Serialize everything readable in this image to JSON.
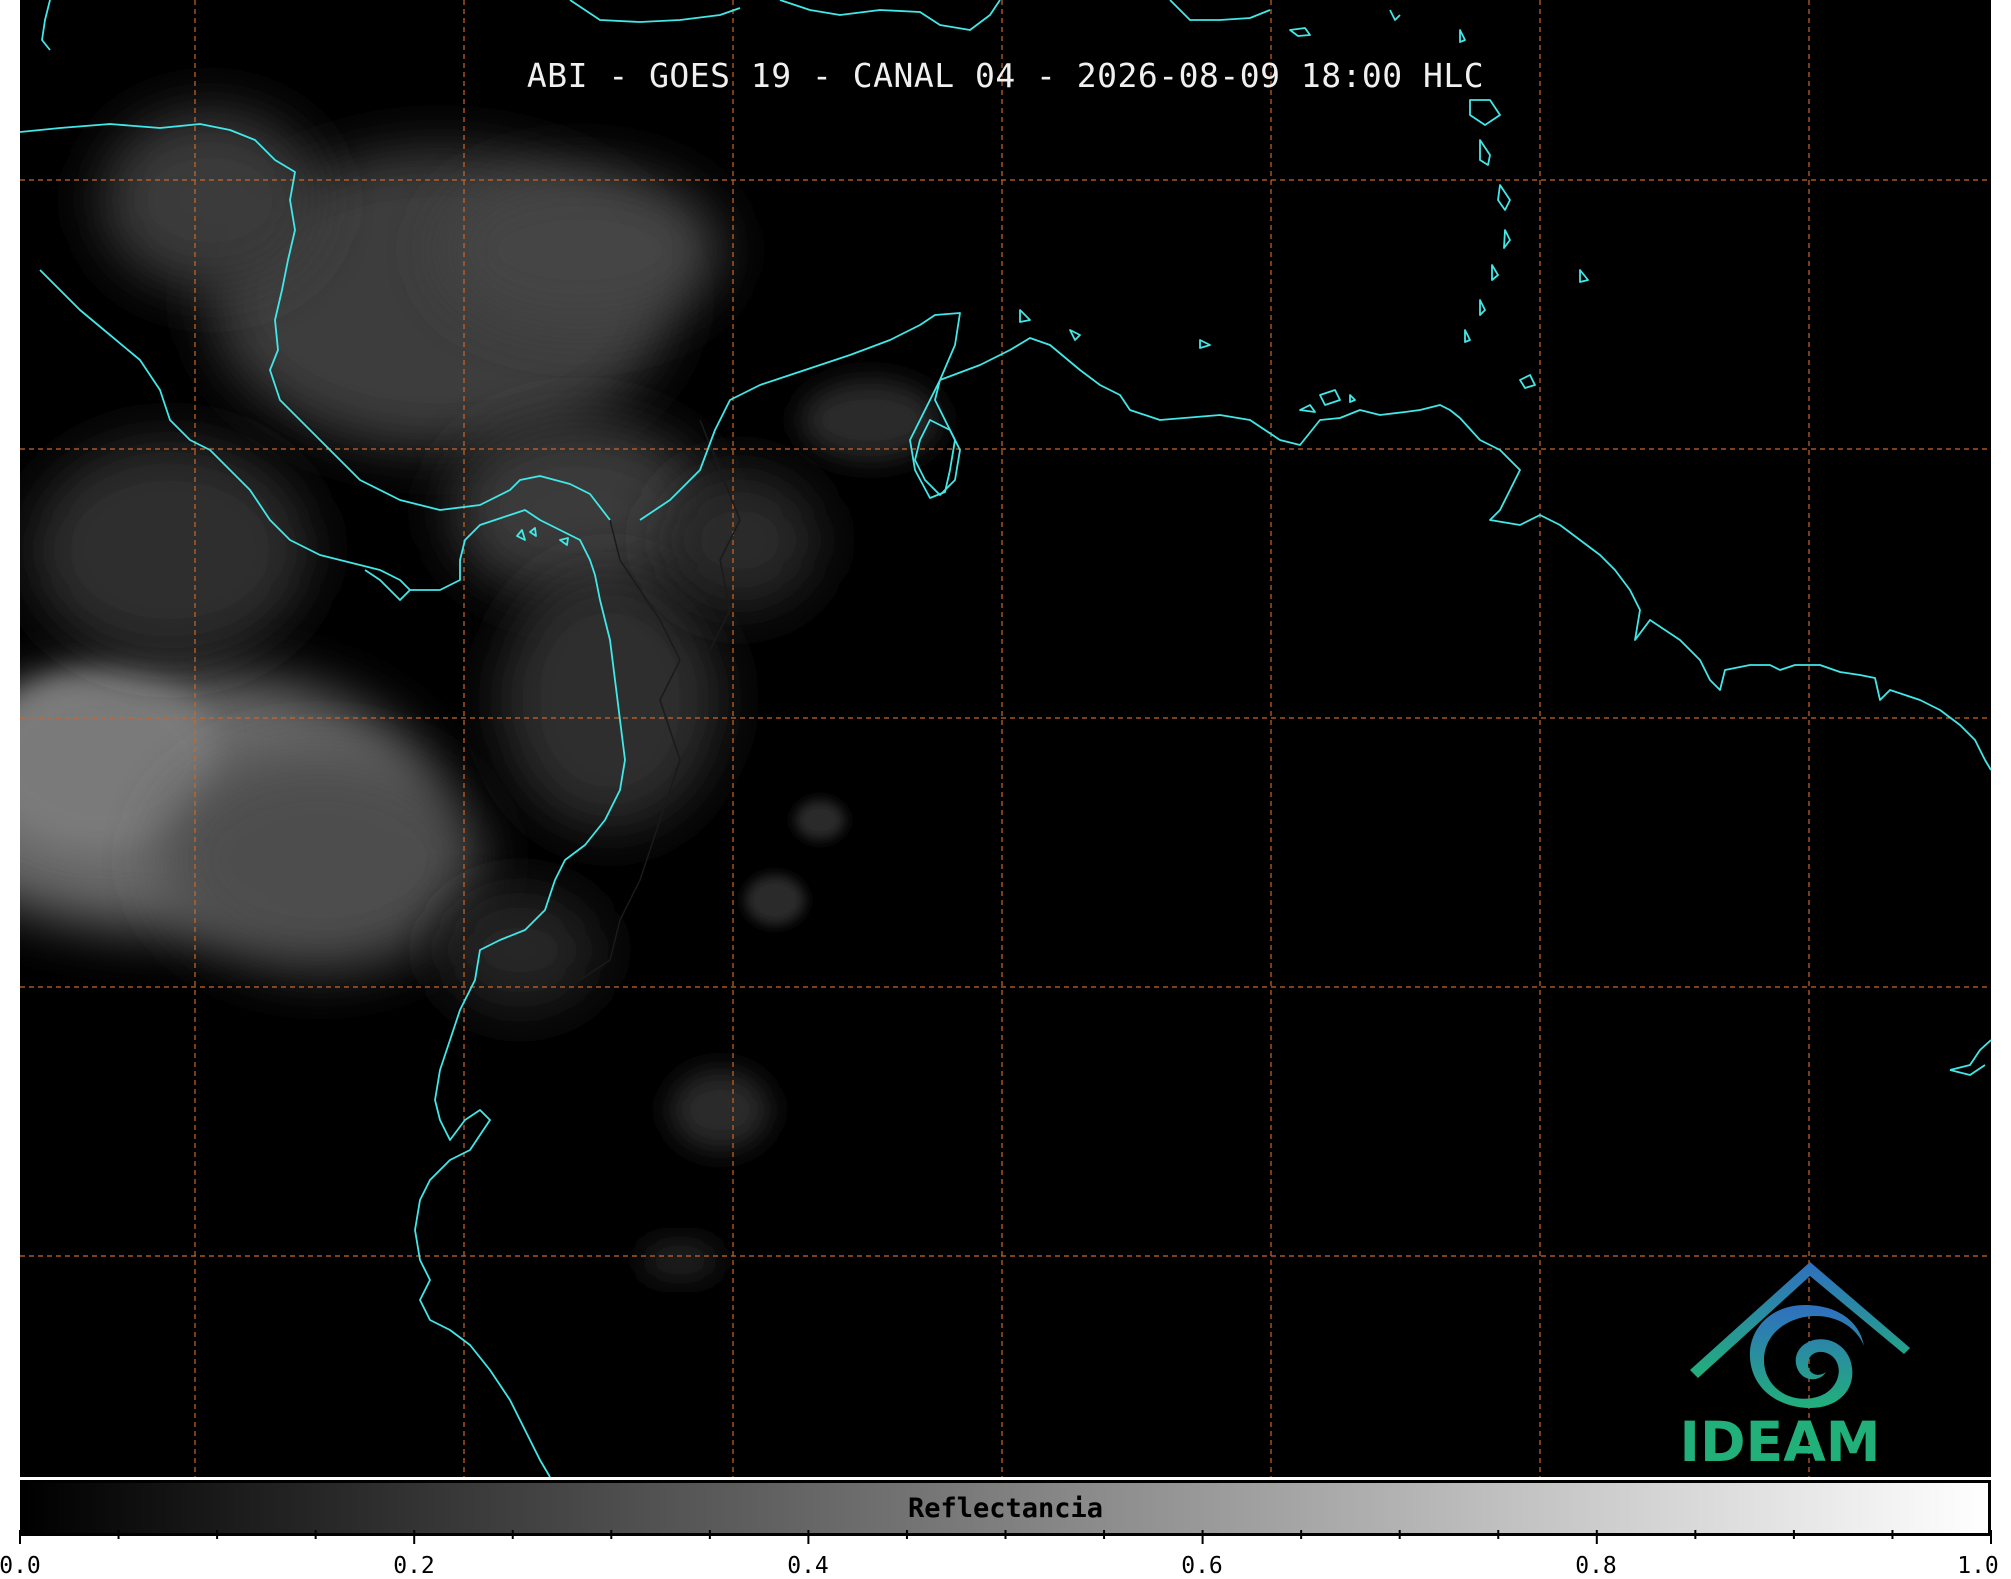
{
  "title": "ABI - GOES 19 - CANAL 04 - 2026-08-09 18:00 HLC",
  "colorbar": {
    "label": "Reflectancia",
    "ticks": [
      "0.0",
      "0.2",
      "0.4",
      "0.6",
      "0.8",
      "1.0"
    ],
    "range": [
      0.0,
      1.0
    ],
    "colormap": "grayscale (black to white)"
  },
  "logo": {
    "text": "IDEAM"
  },
  "map": {
    "background": "#000000",
    "coastline_color": "#40e8e8",
    "gridline_color": "#c8682a",
    "gridline_style": "dashed",
    "cloud_color": "gray"
  }
}
